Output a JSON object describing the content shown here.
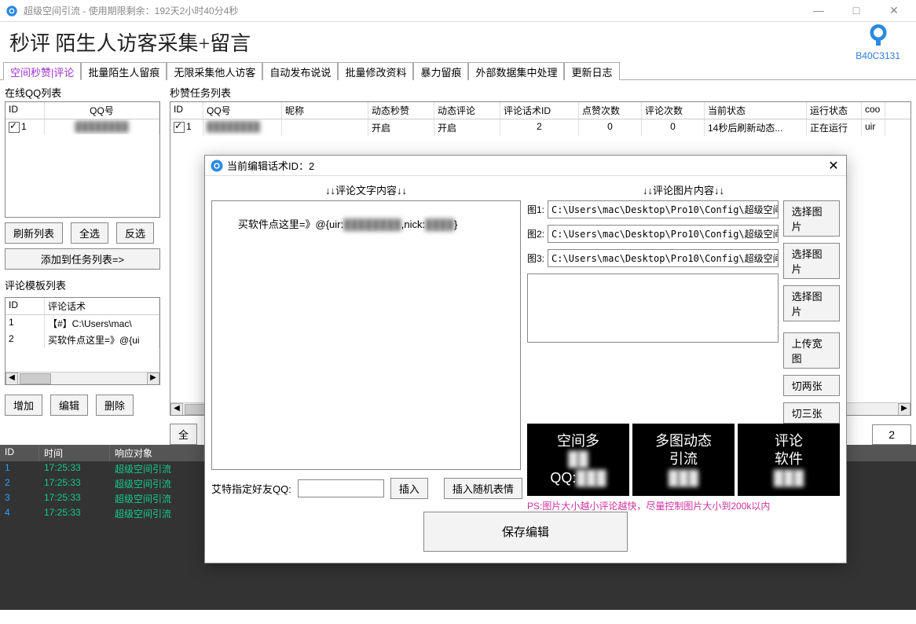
{
  "titlebar": {
    "title": "超级空间引流 - 使用期限剩余：192天2小时40分4秒",
    "minimize": "—",
    "maximize": "□",
    "close": "✕"
  },
  "banner": {
    "title": "秒评 陌生人访客采集+留言",
    "code": "B40C3131"
  },
  "tabs": [
    "空间秒赞|评论",
    "批量陌生人留痕",
    "无限采集他人访客",
    "自动发布说说",
    "批量修改资料",
    "暴力留痕",
    "外部数据集中处理",
    "更新日志"
  ],
  "leftcol": {
    "online_label": "在线QQ列表",
    "header_id": "ID",
    "header_qq": "QQ号",
    "row1_id": "1",
    "row1_qq": "████████",
    "btn_refresh": "刷新列表",
    "btn_selectall": "全选",
    "btn_invert": "反选",
    "btn_addtask": "添加到任务列表=>",
    "template_label": "评论模板列表",
    "tpl_header_id": "ID",
    "tpl_header_text": "评论话术",
    "tpl_row1_id": "1",
    "tpl_row1_text": "【#】C:\\Users\\mac\\",
    "tpl_row2_id": "2",
    "tpl_row2_text": "买软件点这里=》@{ui",
    "btn_add": "增加",
    "btn_edit": "编辑",
    "btn_del": "删除"
  },
  "rightcol": {
    "label": "秒赞任务列表",
    "headers": {
      "id": "ID",
      "qq": "QQ号",
      "nick": "昵称",
      "dzsm": "动态秒赞",
      "dtpl": "动态评论",
      "hsid": "评论话术ID",
      "like": "点赞次数",
      "cmt": "评论次数",
      "state": "当前状态",
      "run": "运行状态",
      "coo": "coo"
    },
    "row1": {
      "id": "1",
      "qq": "████████",
      "nick": "",
      "dzsm": "开启",
      "dtpl": "开启",
      "hsid": "2",
      "like": "0",
      "cmt": "0",
      "state": "14秒后刷新动态...",
      "run": "正在运行",
      "coo": "uir"
    },
    "btn_all": "全",
    "num": "2"
  },
  "log": {
    "h_id": "ID",
    "h_time": "时间",
    "h_target": "响应对象",
    "rows": [
      {
        "id": "1",
        "time": "17:25:33",
        "target": "超级空间引流"
      },
      {
        "id": "2",
        "time": "17:25:33",
        "target": "超级空间引流"
      },
      {
        "id": "3",
        "time": "17:25:33",
        "target": "超级空间引流"
      },
      {
        "id": "4",
        "time": "17:25:33",
        "target": "超级空间引流"
      }
    ]
  },
  "dialog": {
    "title": "当前编辑话术ID：2",
    "close": "✕",
    "text_section": "↓↓评论文字内容↓↓",
    "img_section": "↓↓评论图片内容↓↓",
    "textarea": "买软件点这里=》@{uir:████████,nick:████}",
    "img1_label": "图1:",
    "img2_label": "图2:",
    "img3_label": "图3:",
    "imgpath": "C:\\Users\\mac\\Desktop\\Pro10\\Config\\超级空间",
    "btn_select": "选择图片",
    "btn_upload": "上传宽图",
    "btn_cut2": "切两张",
    "btn_cut3": "切三张",
    "preview1a": "空间多",
    "preview1b": "██",
    "preview1c": "QQ:3██",
    "preview2a": "多图动态",
    "preview2b": "引流",
    "preview2c": "███",
    "preview3a": "评论",
    "preview3b": "软件",
    "preview3c": "███",
    "pinknote": "PS:图片大小越小评论越快，尽量控制图片大小到200k以内",
    "at_label": "艾特指定好友QQ:",
    "btn_insert": "插入",
    "btn_emoji": "插入随机表情",
    "btn_save": "保存编辑"
  }
}
